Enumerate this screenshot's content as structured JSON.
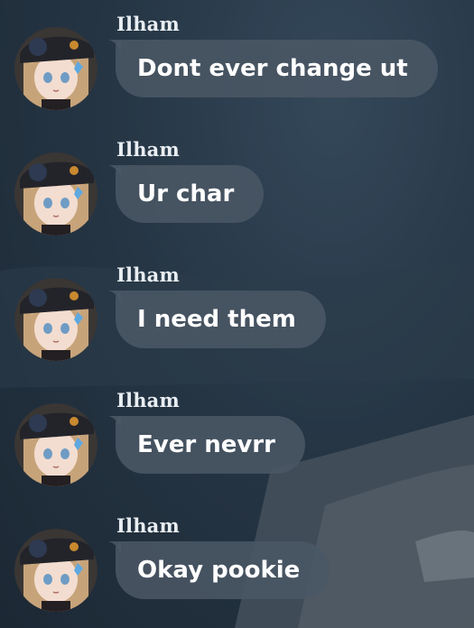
{
  "messages": [
    {
      "sender": "Ilham",
      "text": "Dont ever change ut"
    },
    {
      "sender": "Ilham",
      "text": "Ur char"
    },
    {
      "sender": "Ilham",
      "text": "I need them"
    },
    {
      "sender": "Ilham",
      "text": "Ever nevrr"
    },
    {
      "sender": "Ilham",
      "text": "Okay pookie"
    }
  ],
  "colors": {
    "bubble": "#4a5664",
    "text": "#ffffff",
    "background": "#263645"
  },
  "icons": {
    "avatar": "character-avatar-icon"
  }
}
